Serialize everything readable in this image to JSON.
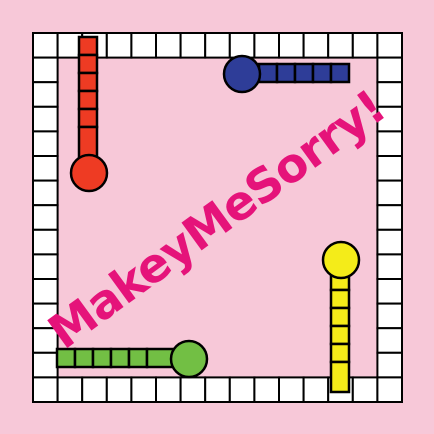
{
  "title": "MakeyMeSorry!",
  "colors": {
    "background": "#f7c8d8",
    "track_square_fill": "#ffffff",
    "outline": "#000000",
    "title": "#e5137a",
    "red": "#ee3b23",
    "blue": "#2e3d98",
    "yellow": "#f4ec19",
    "green": "#72bf44"
  },
  "board": {
    "track_squares_per_side": 15,
    "home_paths": [
      {
        "color": "red",
        "squares": 5,
        "position": "top-left"
      },
      {
        "color": "blue",
        "squares": 5,
        "position": "top-right"
      },
      {
        "color": "yellow",
        "squares": 5,
        "position": "bottom-right"
      },
      {
        "color": "green",
        "squares": 5,
        "position": "bottom-left"
      }
    ]
  }
}
